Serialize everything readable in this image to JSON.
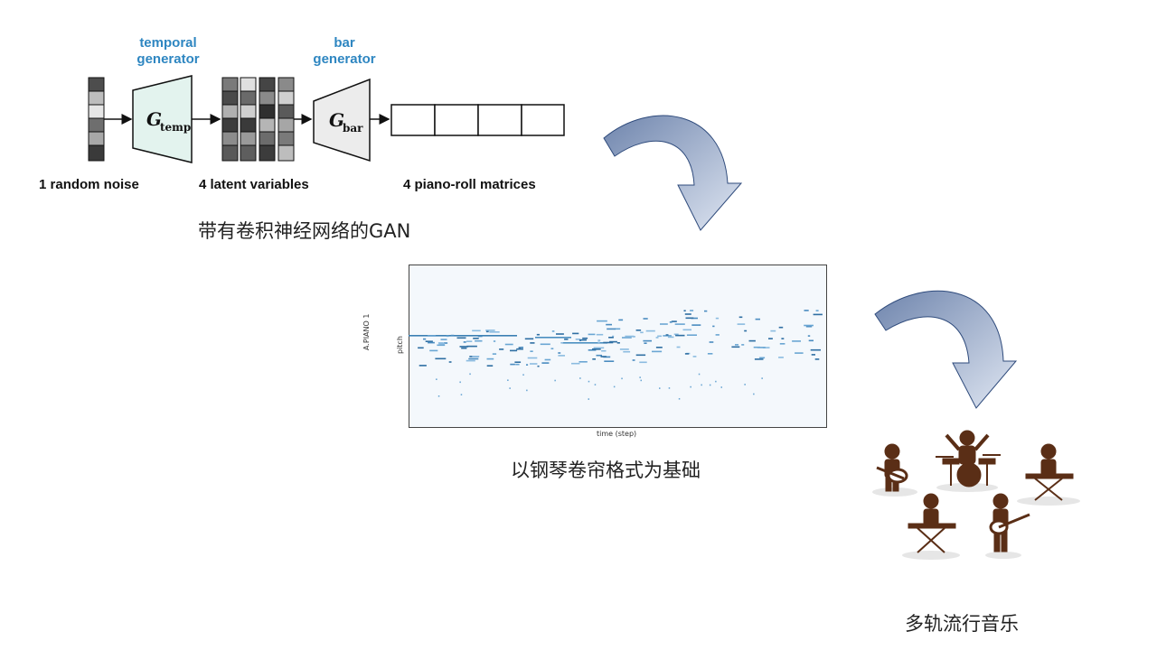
{
  "diagram": {
    "temporal_generator_label": "temporal\ngenerator",
    "bar_generator_label": "bar\ngenerator",
    "g_temp_main": "G",
    "g_temp_sub": "temp",
    "g_bar_main": "G",
    "g_bar_sub": "bar",
    "label_noise": "1 random noise",
    "label_latent": "4 latent variables",
    "label_pianoroll": "4 piano-roll matrices",
    "caption_gan": "带有卷积神经网络的GAN"
  },
  "pianoroll": {
    "ylabel_track": "A.PIANO 1",
    "ylabel_pitch": "pitch",
    "xlabel": "time (step)",
    "caption": "以钢琴卷帘格式为基础"
  },
  "band": {
    "caption": "多轨流行音乐"
  },
  "colors": {
    "accent_blue": "#2e86c1",
    "arrow_fill": "#7f93b8",
    "silhouette": "#5a2e16",
    "generator_temp_fill": "#e3f3ee",
    "generator_bar_fill": "#ececec"
  }
}
